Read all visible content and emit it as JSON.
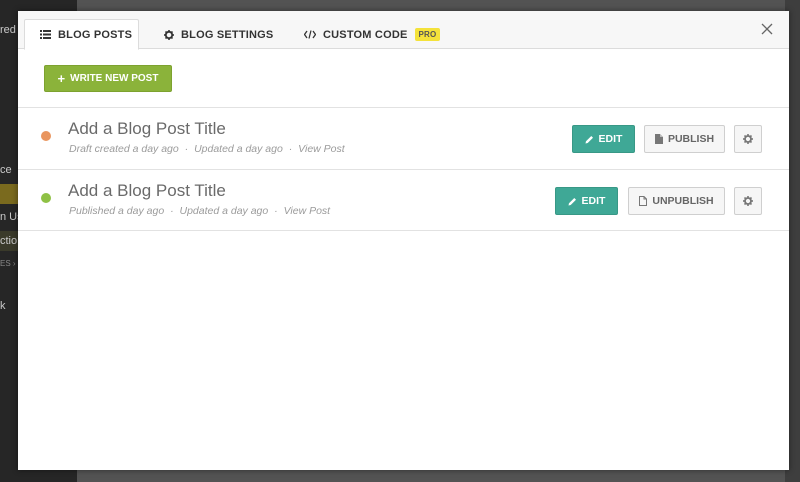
{
  "background": {
    "sidebar_fragments": [
      "red",
      "ce",
      "n Us",
      "ctio",
      "ES ›",
      "k"
    ]
  },
  "tabs": [
    {
      "label": "BLOG POSTS",
      "icon": "list-icon",
      "active": true
    },
    {
      "label": "BLOG SETTINGS",
      "icon": "gear-icon",
      "active": false
    },
    {
      "label": "CUSTOM CODE",
      "icon": "code-icon",
      "active": false,
      "badge": "PRO"
    }
  ],
  "toolbar": {
    "write_label": "WRITE NEW POST",
    "write_icon": "plus-icon"
  },
  "posts": [
    {
      "title": "Add a Blog Post Title",
      "status_color": "#e9955e",
      "meta_status": "Draft created a day ago",
      "meta_updated": "Updated a day ago",
      "meta_link": "View Post",
      "edit_label": "EDIT",
      "toggle_label": "PUBLISH"
    },
    {
      "title": "Add a Blog Post Title",
      "status_color": "#8fc145",
      "meta_status": "Published a day ago",
      "meta_updated": "Updated a day ago",
      "meta_link": "View Post",
      "edit_label": "EDIT",
      "toggle_label": "UNPUBLISH"
    }
  ],
  "meta_separator": "·",
  "colors": {
    "accent_green": "#8bb33a",
    "edit_teal": "#3fa896",
    "badge_yellow": "#f4e23a"
  }
}
